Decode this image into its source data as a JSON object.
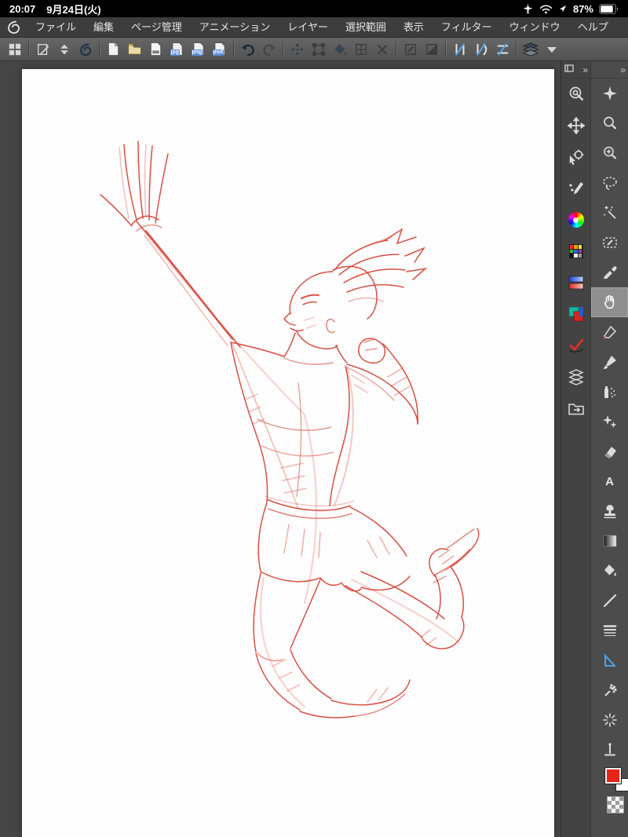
{
  "status_bar": {
    "time": "20:07",
    "date": "9月24日(火)",
    "battery": "87%",
    "icons": [
      "airplane-icon",
      "wifi-icon",
      "location-arrow-icon",
      "battery-icon"
    ]
  },
  "menu_bar": {
    "logo": "clip-studio-logo",
    "items": [
      "ファイル",
      "編集",
      "ページ管理",
      "アニメーション",
      "レイヤー",
      "選択範囲",
      "表示",
      "フィルター",
      "ウィンドウ",
      "ヘルプ"
    ]
  },
  "toolbar": {
    "export_badges": [
      "jpg",
      "png",
      "psd"
    ],
    "icons": [
      "workspace-grid",
      "page-tool",
      "sort-arrows",
      "clip-studio-badge",
      "new-canvas",
      "open-file",
      "save-file",
      "export-jpg",
      "export-png",
      "export-psd",
      "undo",
      "redo",
      "snap-dots",
      "transform-handles",
      "fill-bucket",
      "mesh-transform",
      "clear-mark",
      "pencil-box",
      "gradient-box",
      "ruler-snap",
      "special-ruler-snap",
      "grid-snap",
      "layers-stack",
      "tool-dropdown"
    ]
  },
  "right_panel": {
    "expand_glyph": "»",
    "dock_tools": [
      "loupe",
      "move-canvas",
      "operation",
      "pen-touch",
      "color-wheel",
      "color-set",
      "color-slider",
      "color-history",
      "approx-color",
      "layer-list",
      "folder-nav"
    ],
    "tools": [
      "sparkle",
      "zoom",
      "zoom-fit",
      "lasso",
      "magic-wand",
      "selection-pen",
      "eyedropper",
      "hand",
      "marker",
      "brush",
      "airbrush",
      "decoration",
      "eraser",
      "text",
      "stamp",
      "gradient",
      "bucket",
      "line",
      "hatching",
      "ruler",
      "spray",
      "sunburst",
      "perpendicular"
    ],
    "selected_tool": "hand",
    "text_tool_glyph": "A",
    "colors": {
      "foreground": "#e8231a",
      "background": "#ffffff"
    }
  },
  "canvas": {
    "description": "red rough pencil sketch of a volleyball player jumping to spike",
    "sketch_color": "#d63c2f",
    "paper_color": "#fdfdfd"
  }
}
